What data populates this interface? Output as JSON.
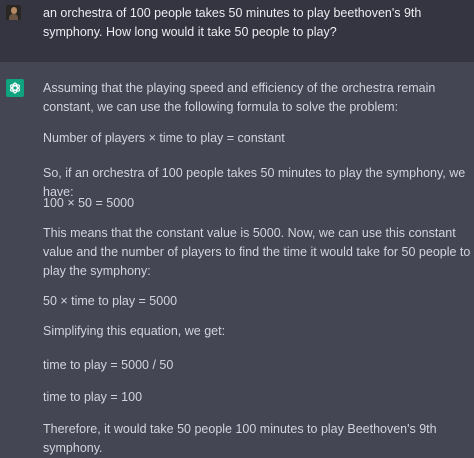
{
  "user": {
    "avatar": "user-photo-avatar",
    "message": "an orchestra of 100 people takes 50 minutes to play beethoven's 9th symphony. How long would it take 50 people to play?"
  },
  "assistant": {
    "avatar": "openai-logo-icon",
    "paragraphs": [
      "Assuming that the playing speed and efficiency of the orchestra remain constant, we can use the following formula to solve the problem:",
      "Number of players × time to play = constant",
      "So, if an orchestra of 100 people takes 50 minutes to play the symphony, we have:",
      "100 × 50 = 5000",
      "This means that the constant value is 5000. Now, we can use this constant value and the number of players to find the time it would take for 50 people to play the symphony:",
      "50 × time to play = 5000",
      "Simplifying this equation, we get:",
      "time to play = 5000 / 50",
      "time to play = 100",
      "Therefore, it would take 50 people 100 minutes to play Beethoven's 9th symphony."
    ]
  },
  "colors": {
    "user_bg": "#343541",
    "assistant_bg": "#444654",
    "accent": "#10a37f",
    "text": "#d1d5db"
  }
}
